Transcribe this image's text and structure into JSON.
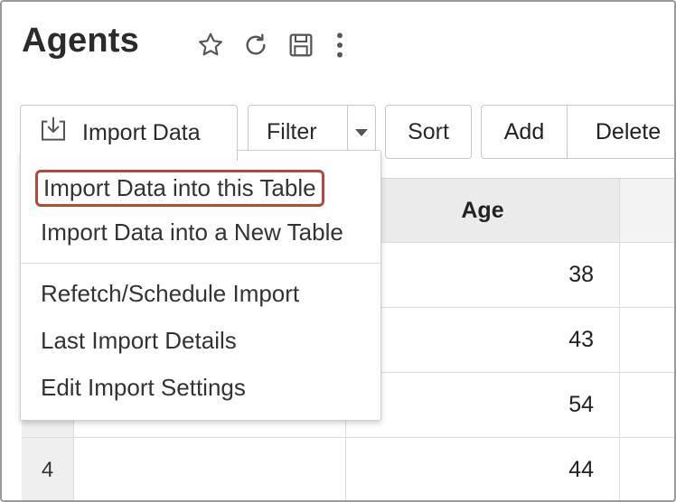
{
  "page": {
    "title": "Agents",
    "icons": [
      "star-icon",
      "refresh-icon",
      "save-icon",
      "more-vertical-icon"
    ]
  },
  "toolbar": {
    "import_label": "Import Data",
    "filter_label": "Filter",
    "sort_label": "Sort",
    "add_label": "Add",
    "delete_label": "Delete"
  },
  "import_menu": {
    "items": [
      "Import Data into this Table",
      "Import Data into a New Table",
      "Refetch/Schedule Import",
      "Last Import Details",
      "Edit Import Settings"
    ],
    "highlighted_index": 0,
    "highlight_color": "#b5483e"
  },
  "table": {
    "columns": [
      "",
      "",
      "Age",
      ""
    ],
    "rows": [
      {
        "index": "",
        "age": "38"
      },
      {
        "index": "",
        "age": "43"
      },
      {
        "index": "",
        "age": "54"
      },
      {
        "index": "4",
        "age": "44"
      }
    ]
  }
}
